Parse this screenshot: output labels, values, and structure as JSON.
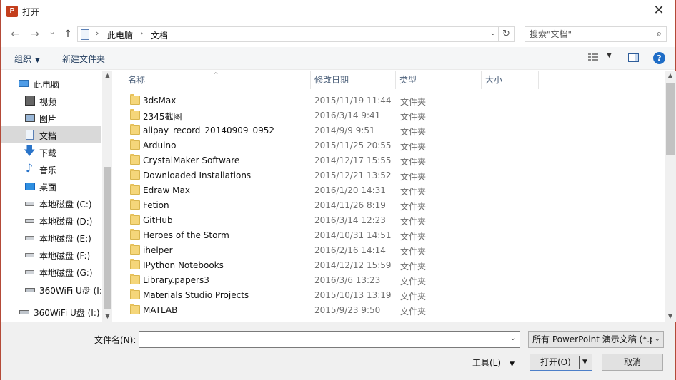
{
  "window": {
    "title": "打开",
    "app_icon": "P",
    "close_glyph": "✕"
  },
  "nav": {
    "back": "←",
    "forward": "→",
    "recent": "⌄",
    "up": "↑",
    "breadcrumb": [
      "此电脑",
      "文档"
    ],
    "separator": "›",
    "refresh": "↻",
    "search_placeholder": "搜索\"文档\""
  },
  "toolbar": {
    "organize": "组织",
    "new_folder": "新建文件夹",
    "help": "?"
  },
  "sidebar": {
    "items": [
      {
        "label": "此电脑",
        "icon": "computer-icon"
      },
      {
        "label": "视频",
        "icon": "video-icon"
      },
      {
        "label": "图片",
        "icon": "pictures-icon"
      },
      {
        "label": "文档",
        "icon": "documents-icon",
        "selected": true
      },
      {
        "label": "下载",
        "icon": "download-icon"
      },
      {
        "label": "音乐",
        "icon": "music-icon"
      },
      {
        "label": "桌面",
        "icon": "desktop-icon"
      },
      {
        "label": "本地磁盘 (C:)",
        "icon": "drive-icon"
      },
      {
        "label": "本地磁盘 (D:)",
        "icon": "drive-icon"
      },
      {
        "label": "本地磁盘 (E:)",
        "icon": "drive-icon"
      },
      {
        "label": "本地磁盘 (F:)",
        "icon": "drive-icon"
      },
      {
        "label": "本地磁盘 (G:)",
        "icon": "drive-icon"
      },
      {
        "label": "360WiFi U盘 (I:",
        "icon": "usb-drive-icon"
      },
      {
        "label": "360WiFi U盘 (I:)",
        "icon": "usb-drive-icon"
      }
    ]
  },
  "columns": {
    "name": "名称",
    "date": "修改日期",
    "type": "类型",
    "size": "大小"
  },
  "files": [
    {
      "name": "3dsMax",
      "date": "2015/11/19 11:44",
      "type": "文件夹"
    },
    {
      "name": "2345截图",
      "date": "2016/3/14 9:41",
      "type": "文件夹"
    },
    {
      "name": "alipay_record_20140909_0952",
      "date": "2014/9/9 9:51",
      "type": "文件夹"
    },
    {
      "name": "Arduino",
      "date": "2015/11/25 20:55",
      "type": "文件夹"
    },
    {
      "name": "CrystalMaker Software",
      "date": "2014/12/17 15:55",
      "type": "文件夹"
    },
    {
      "name": "Downloaded Installations",
      "date": "2015/12/21 13:52",
      "type": "文件夹"
    },
    {
      "name": "Edraw Max",
      "date": "2016/1/20 14:31",
      "type": "文件夹"
    },
    {
      "name": "Fetion",
      "date": "2014/11/26 8:19",
      "type": "文件夹"
    },
    {
      "name": "GitHub",
      "date": "2016/3/14 12:23",
      "type": "文件夹"
    },
    {
      "name": "Heroes of the Storm",
      "date": "2014/10/31 14:51",
      "type": "文件夹"
    },
    {
      "name": "ihelper",
      "date": "2016/2/16 14:14",
      "type": "文件夹"
    },
    {
      "name": "IPython Notebooks",
      "date": "2014/12/12 15:59",
      "type": "文件夹"
    },
    {
      "name": "Library.papers3",
      "date": "2016/3/6 13:23",
      "type": "文件夹"
    },
    {
      "name": "Materials Studio Projects",
      "date": "2015/10/13 13:19",
      "type": "文件夹"
    },
    {
      "name": "MATLAB",
      "date": "2015/9/23 9:50",
      "type": "文件夹"
    }
  ],
  "bottom": {
    "filename_label": "文件名(N):",
    "filename_value": "",
    "filetype": "所有 PowerPoint 演示文稿 (*.p",
    "tools": "工具(L)",
    "open": "打开(O)",
    "cancel": "取消"
  },
  "colors": {
    "accent": "#1f6dc7",
    "selected": "#d9d9d9",
    "folder": "#f5d67a",
    "window_border": "#b44a38"
  }
}
